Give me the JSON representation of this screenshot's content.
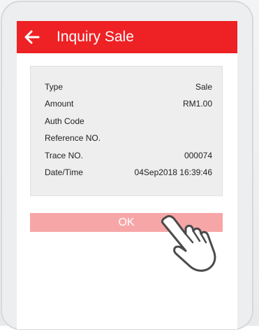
{
  "header": {
    "title": "Inquiry Sale",
    "back_icon": "back-arrow-icon"
  },
  "details": [
    {
      "label": "Type",
      "value": "Sale"
    },
    {
      "label": "Amount",
      "value": "RM1.00"
    },
    {
      "label": "Auth Code",
      "value": ""
    },
    {
      "label": "Reference NO.",
      "value": ""
    },
    {
      "label": "Trace NO.",
      "value": "000074"
    },
    {
      "label": "Date/Time",
      "value": "04Sep2018 16:39:46"
    }
  ],
  "actions": {
    "ok_label": "OK"
  },
  "overlay": {
    "pointer_icon": "tap-hand-icon"
  },
  "colors": {
    "brand_red": "#ee2124",
    "button_disabled_pink": "#f7a6a7",
    "card_gray": "#eeeeee"
  }
}
